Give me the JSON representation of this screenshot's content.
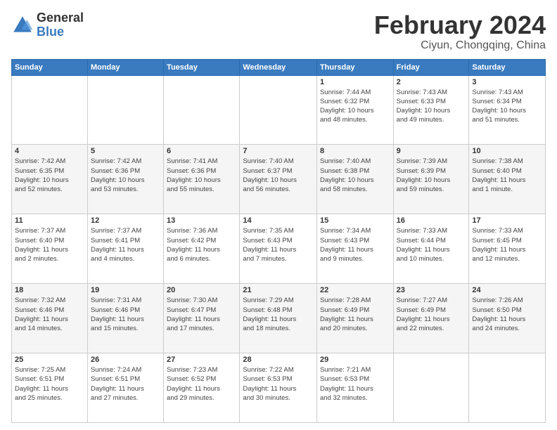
{
  "header": {
    "logo": {
      "general": "General",
      "blue": "Blue"
    },
    "title": "February 2024",
    "location": "Ciyun, Chongqing, China"
  },
  "weekdays": [
    "Sunday",
    "Monday",
    "Tuesday",
    "Wednesday",
    "Thursday",
    "Friday",
    "Saturday"
  ],
  "weeks": [
    [
      {
        "day": "",
        "info": ""
      },
      {
        "day": "",
        "info": ""
      },
      {
        "day": "",
        "info": ""
      },
      {
        "day": "",
        "info": ""
      },
      {
        "day": "1",
        "info": "Sunrise: 7:44 AM\nSunset: 6:32 PM\nDaylight: 10 hours\nand 48 minutes."
      },
      {
        "day": "2",
        "info": "Sunrise: 7:43 AM\nSunset: 6:33 PM\nDaylight: 10 hours\nand 49 minutes."
      },
      {
        "day": "3",
        "info": "Sunrise: 7:43 AM\nSunset: 6:34 PM\nDaylight: 10 hours\nand 51 minutes."
      }
    ],
    [
      {
        "day": "4",
        "info": "Sunrise: 7:42 AM\nSunset: 6:35 PM\nDaylight: 10 hours\nand 52 minutes."
      },
      {
        "day": "5",
        "info": "Sunrise: 7:42 AM\nSunset: 6:36 PM\nDaylight: 10 hours\nand 53 minutes."
      },
      {
        "day": "6",
        "info": "Sunrise: 7:41 AM\nSunset: 6:36 PM\nDaylight: 10 hours\nand 55 minutes."
      },
      {
        "day": "7",
        "info": "Sunrise: 7:40 AM\nSunset: 6:37 PM\nDaylight: 10 hours\nand 56 minutes."
      },
      {
        "day": "8",
        "info": "Sunrise: 7:40 AM\nSunset: 6:38 PM\nDaylight: 10 hours\nand 58 minutes."
      },
      {
        "day": "9",
        "info": "Sunrise: 7:39 AM\nSunset: 6:39 PM\nDaylight: 10 hours\nand 59 minutes."
      },
      {
        "day": "10",
        "info": "Sunrise: 7:38 AM\nSunset: 6:40 PM\nDaylight: 11 hours\nand 1 minute."
      }
    ],
    [
      {
        "day": "11",
        "info": "Sunrise: 7:37 AM\nSunset: 6:40 PM\nDaylight: 11 hours\nand 2 minutes."
      },
      {
        "day": "12",
        "info": "Sunrise: 7:37 AM\nSunset: 6:41 PM\nDaylight: 11 hours\nand 4 minutes."
      },
      {
        "day": "13",
        "info": "Sunrise: 7:36 AM\nSunset: 6:42 PM\nDaylight: 11 hours\nand 6 minutes."
      },
      {
        "day": "14",
        "info": "Sunrise: 7:35 AM\nSunset: 6:43 PM\nDaylight: 11 hours\nand 7 minutes."
      },
      {
        "day": "15",
        "info": "Sunrise: 7:34 AM\nSunset: 6:43 PM\nDaylight: 11 hours\nand 9 minutes."
      },
      {
        "day": "16",
        "info": "Sunrise: 7:33 AM\nSunset: 6:44 PM\nDaylight: 11 hours\nand 10 minutes."
      },
      {
        "day": "17",
        "info": "Sunrise: 7:33 AM\nSunset: 6:45 PM\nDaylight: 11 hours\nand 12 minutes."
      }
    ],
    [
      {
        "day": "18",
        "info": "Sunrise: 7:32 AM\nSunset: 6:46 PM\nDaylight: 11 hours\nand 14 minutes."
      },
      {
        "day": "19",
        "info": "Sunrise: 7:31 AM\nSunset: 6:46 PM\nDaylight: 11 hours\nand 15 minutes."
      },
      {
        "day": "20",
        "info": "Sunrise: 7:30 AM\nSunset: 6:47 PM\nDaylight: 11 hours\nand 17 minutes."
      },
      {
        "day": "21",
        "info": "Sunrise: 7:29 AM\nSunset: 6:48 PM\nDaylight: 11 hours\nand 18 minutes."
      },
      {
        "day": "22",
        "info": "Sunrise: 7:28 AM\nSunset: 6:49 PM\nDaylight: 11 hours\nand 20 minutes."
      },
      {
        "day": "23",
        "info": "Sunrise: 7:27 AM\nSunset: 6:49 PM\nDaylight: 11 hours\nand 22 minutes."
      },
      {
        "day": "24",
        "info": "Sunrise: 7:26 AM\nSunset: 6:50 PM\nDaylight: 11 hours\nand 24 minutes."
      }
    ],
    [
      {
        "day": "25",
        "info": "Sunrise: 7:25 AM\nSunset: 6:51 PM\nDaylight: 11 hours\nand 25 minutes."
      },
      {
        "day": "26",
        "info": "Sunrise: 7:24 AM\nSunset: 6:51 PM\nDaylight: 11 hours\nand 27 minutes."
      },
      {
        "day": "27",
        "info": "Sunrise: 7:23 AM\nSunset: 6:52 PM\nDaylight: 11 hours\nand 29 minutes."
      },
      {
        "day": "28",
        "info": "Sunrise: 7:22 AM\nSunset: 6:53 PM\nDaylight: 11 hours\nand 30 minutes."
      },
      {
        "day": "29",
        "info": "Sunrise: 7:21 AM\nSunset: 6:53 PM\nDaylight: 11 hours\nand 32 minutes."
      },
      {
        "day": "",
        "info": ""
      },
      {
        "day": "",
        "info": ""
      }
    ]
  ]
}
